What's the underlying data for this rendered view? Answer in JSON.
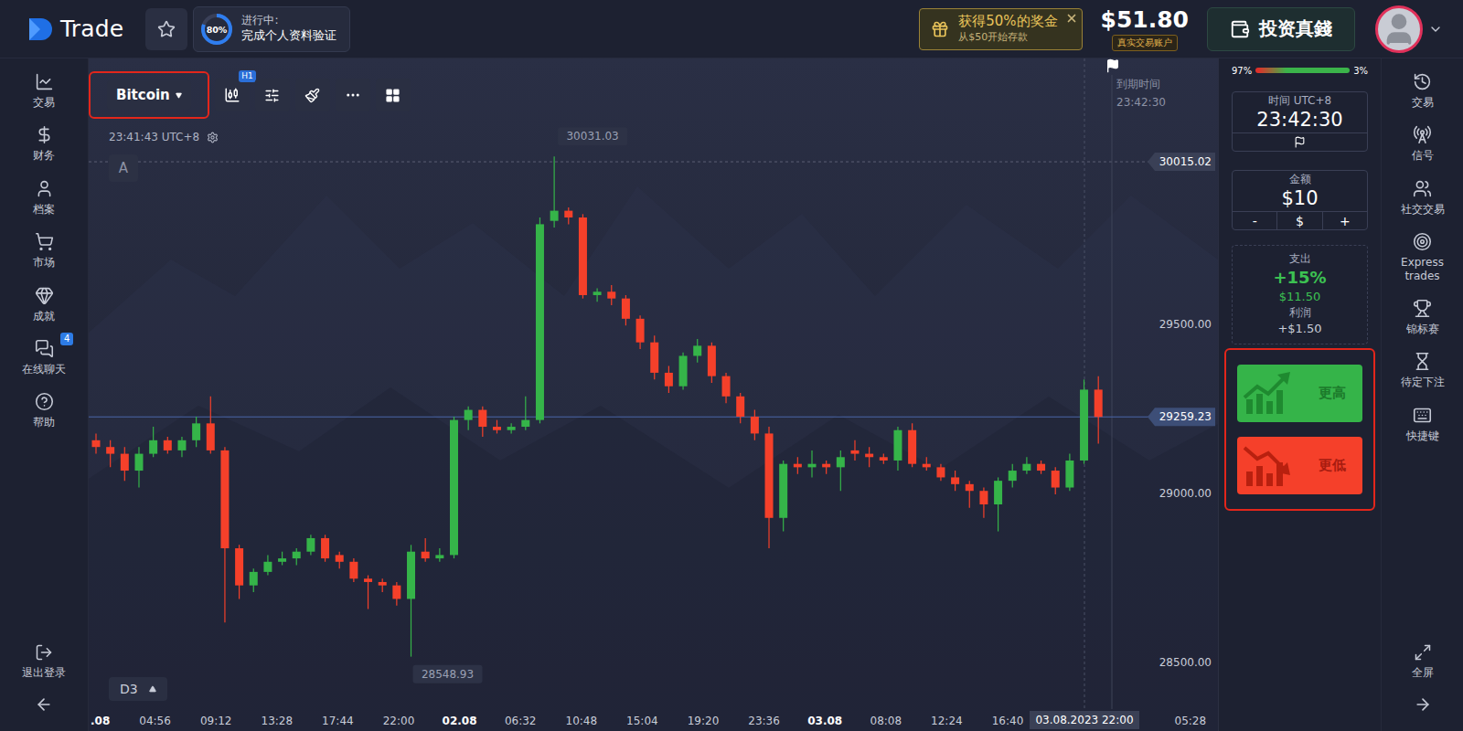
{
  "app": {
    "logo": "Trade"
  },
  "top_bar": {
    "favorite": {
      "selected": false
    },
    "progress": {
      "percent": "80%",
      "level": 0.8,
      "title": "进行中:",
      "subtitle": "完成个人资料验证"
    },
    "bonus": {
      "title": "获得50%的奖金",
      "subtitle": "从$50开始存款"
    },
    "balance": {
      "amount": "$51.80",
      "account": "真实交易账户"
    },
    "deposit_button": "投资真錢"
  },
  "left_nav": {
    "items": [
      {
        "label": "交易",
        "badge": ""
      },
      {
        "label": "财务",
        "badge": ""
      },
      {
        "label": "档案",
        "badge": ""
      },
      {
        "label": "市场",
        "badge": ""
      },
      {
        "label": "成就",
        "badge": ""
      },
      {
        "label": "在线聊天",
        "badge": "4"
      },
      {
        "label": "帮助",
        "badge": ""
      }
    ],
    "footer": [
      {
        "label": "退出登录"
      }
    ]
  },
  "right_nav": {
    "items": [
      {
        "label": "交易"
      },
      {
        "label": "信号"
      },
      {
        "label": "社交交易"
      },
      {
        "label": "Express trades"
      },
      {
        "label": "锦标赛"
      },
      {
        "label": "待定下注"
      },
      {
        "label": "快捷键"
      }
    ],
    "footer": [
      {
        "label": "全屏"
      }
    ]
  },
  "chart": {
    "asset": "Bitcoin",
    "annotated": true,
    "timeframe": "H1",
    "clock": "23:41:43 UTC+8",
    "drawing_mode": "A",
    "zoom": "D3",
    "expiry": {
      "label": "到期时间",
      "time": "23:42:30"
    },
    "high": {
      "value": 30031.03,
      "label": "30031.03"
    },
    "low": {
      "value": 28548.93,
      "label": "28548.93"
    },
    "reference": {
      "value": 30015.02,
      "label": "30015.02"
    },
    "current": {
      "value": 29259.23,
      "label": "29259.23"
    },
    "price_ticks": [
      "29500.00",
      "29000.00",
      "28500.00"
    ],
    "time_ticks": [
      {
        "label": ".08",
        "kind": "date"
      },
      {
        "label": "04:56",
        "kind": "time"
      },
      {
        "label": "09:12",
        "kind": "time"
      },
      {
        "label": "13:28",
        "kind": "time"
      },
      {
        "label": "17:44",
        "kind": "time"
      },
      {
        "label": "22:00",
        "kind": "time"
      },
      {
        "label": "02.08",
        "kind": "date"
      },
      {
        "label": "06:32",
        "kind": "time"
      },
      {
        "label": "10:48",
        "kind": "time"
      },
      {
        "label": "15:04",
        "kind": "time"
      },
      {
        "label": "19:20",
        "kind": "time"
      },
      {
        "label": "23:36",
        "kind": "time"
      },
      {
        "label": "03.08",
        "kind": "date"
      },
      {
        "label": "08:08",
        "kind": "time"
      },
      {
        "label": "12:24",
        "kind": "time"
      },
      {
        "label": "16:40",
        "kind": "time"
      },
      {
        "label": "03.08.2023 22:00",
        "kind": "cursor"
      },
      {
        "label": "05:28",
        "kind": "time"
      }
    ],
    "candles": [
      [
        29190,
        29210,
        29150,
        29170
      ],
      [
        29170,
        29190,
        29110,
        29150
      ],
      [
        29150,
        29170,
        29070,
        29100
      ],
      [
        29100,
        29170,
        29050,
        29150
      ],
      [
        29150,
        29230,
        29140,
        29190
      ],
      [
        29190,
        29200,
        29150,
        29160
      ],
      [
        29160,
        29200,
        29140,
        29190
      ],
      [
        29190,
        29260,
        29170,
        29240
      ],
      [
        29240,
        29320,
        29150,
        29160
      ],
      [
        29160,
        29170,
        28650,
        28870
      ],
      [
        28870,
        28880,
        28720,
        28760
      ],
      [
        28760,
        28810,
        28740,
        28800
      ],
      [
        28800,
        28850,
        28790,
        28830
      ],
      [
        28830,
        28860,
        28820,
        28840
      ],
      [
        28840,
        28870,
        28820,
        28860
      ],
      [
        28860,
        28910,
        28850,
        28900
      ],
      [
        28900,
        28910,
        28830,
        28840
      ],
      [
        28850,
        28860,
        28810,
        28830
      ],
      [
        28830,
        28840,
        28770,
        28780
      ],
      [
        28780,
        28790,
        28690,
        28770
      ],
      [
        28770,
        28780,
        28740,
        28760
      ],
      [
        28760,
        28770,
        28700,
        28720
      ],
      [
        28720,
        28880,
        28548.93,
        28860
      ],
      [
        28860,
        28900,
        28830,
        28840
      ],
      [
        28840,
        28870,
        28830,
        28850
      ],
      [
        28850,
        29260,
        28840,
        29250
      ],
      [
        29250,
        29290,
        29220,
        29280
      ],
      [
        29280,
        29290,
        29200,
        29230
      ],
      [
        29230,
        29250,
        29210,
        29220
      ],
      [
        29220,
        29240,
        29210,
        29230
      ],
      [
        29230,
        29320,
        29220,
        29250
      ],
      [
        29250,
        29850,
        29240,
        29830
      ],
      [
        29840,
        30031.03,
        29820,
        29870
      ],
      [
        29870,
        29880,
        29830,
        29850
      ],
      [
        29850,
        29860,
        29610,
        29620
      ],
      [
        29620,
        29640,
        29600,
        29630
      ],
      [
        29630,
        29650,
        29590,
        29610
      ],
      [
        29610,
        29620,
        29530,
        29550
      ],
      [
        29550,
        29560,
        29460,
        29480
      ],
      [
        29480,
        29500,
        29370,
        29390
      ],
      [
        29390,
        29410,
        29330,
        29350
      ],
      [
        29350,
        29450,
        29340,
        29440
      ],
      [
        29440,
        29490,
        29420,
        29470
      ],
      [
        29470,
        29480,
        29360,
        29380
      ],
      [
        29380,
        29390,
        29300,
        29320
      ],
      [
        29320,
        29330,
        29240,
        29260
      ],
      [
        29260,
        29280,
        29190,
        29210
      ],
      [
        29210,
        29230,
        28870,
        28960
      ],
      [
        28960,
        29130,
        28920,
        29120
      ],
      [
        29120,
        29140,
        29090,
        29110
      ],
      [
        29110,
        29160,
        29080,
        29120
      ],
      [
        29120,
        29130,
        29090,
        29110
      ],
      [
        29110,
        29160,
        29040,
        29140
      ],
      [
        29160,
        29190,
        29130,
        29150
      ],
      [
        29150,
        29170,
        29110,
        29140
      ],
      [
        29140,
        29150,
        29120,
        29130
      ],
      [
        29130,
        29230,
        29100,
        29220
      ],
      [
        29220,
        29240,
        29110,
        29120
      ],
      [
        29120,
        29140,
        29100,
        29110
      ],
      [
        29110,
        29120,
        29070,
        29080
      ],
      [
        29080,
        29100,
        29040,
        29060
      ],
      [
        29060,
        29070,
        28990,
        29040
      ],
      [
        29040,
        29050,
        28960,
        29000
      ],
      [
        29000,
        29080,
        28920,
        29070
      ],
      [
        29070,
        29120,
        29050,
        29100
      ],
      [
        29100,
        29140,
        29090,
        29120
      ],
      [
        29120,
        29130,
        29090,
        29100
      ],
      [
        29100,
        29110,
        29030,
        29050
      ],
      [
        29050,
        29150,
        29040,
        29130
      ],
      [
        29130,
        29370,
        29120,
        29340
      ],
      [
        29340,
        29380,
        29180,
        29259.23
      ]
    ]
  },
  "trade_panel": {
    "sentiment": {
      "left": "97%",
      "right": "3%",
      "level": 0.97
    },
    "time": {
      "label": "时间 UTC+8",
      "value": "23:42:30"
    },
    "amount": {
      "label": "金额",
      "value": "$10",
      "controls": [
        "-",
        "$",
        "+"
      ]
    },
    "payout": {
      "label": "支出",
      "percent": "+15%",
      "total": "$11.50",
      "profit_label": "利润",
      "profit": "+$1.50"
    },
    "annotated": true,
    "buttons": [
      {
        "label": "更高",
        "kind": "up"
      },
      {
        "label": "更低",
        "kind": "down"
      }
    ]
  }
}
